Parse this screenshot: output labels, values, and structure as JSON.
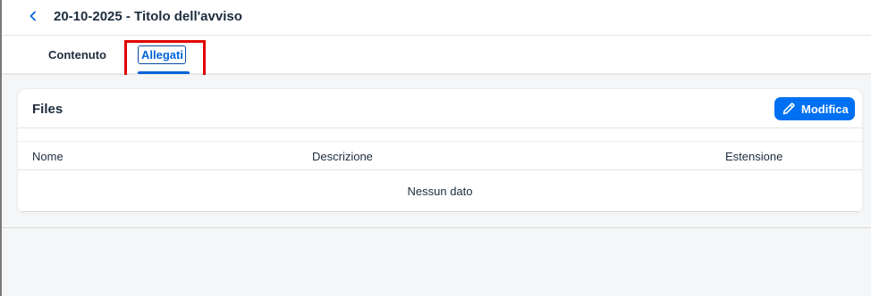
{
  "header": {
    "title": "20-10-2025 - Titolo dell'avviso",
    "back_icon": "chevron-left-icon"
  },
  "tabs": [
    {
      "label": "Contenuto",
      "selected": false
    },
    {
      "label": "Allegati",
      "selected": true
    }
  ],
  "files_section": {
    "title": "Files",
    "edit_button_label": "Modifica",
    "edit_icon": "pencil-icon",
    "columns": [
      "Nome",
      "Descrizione",
      "Estensione"
    ],
    "empty_message": "Nessun dato"
  },
  "colors": {
    "accent": "#0064d9",
    "button_bg": "#0070f2",
    "highlight": "#e00000",
    "text": "#1d2d3e",
    "background": "#f5f6f7"
  }
}
